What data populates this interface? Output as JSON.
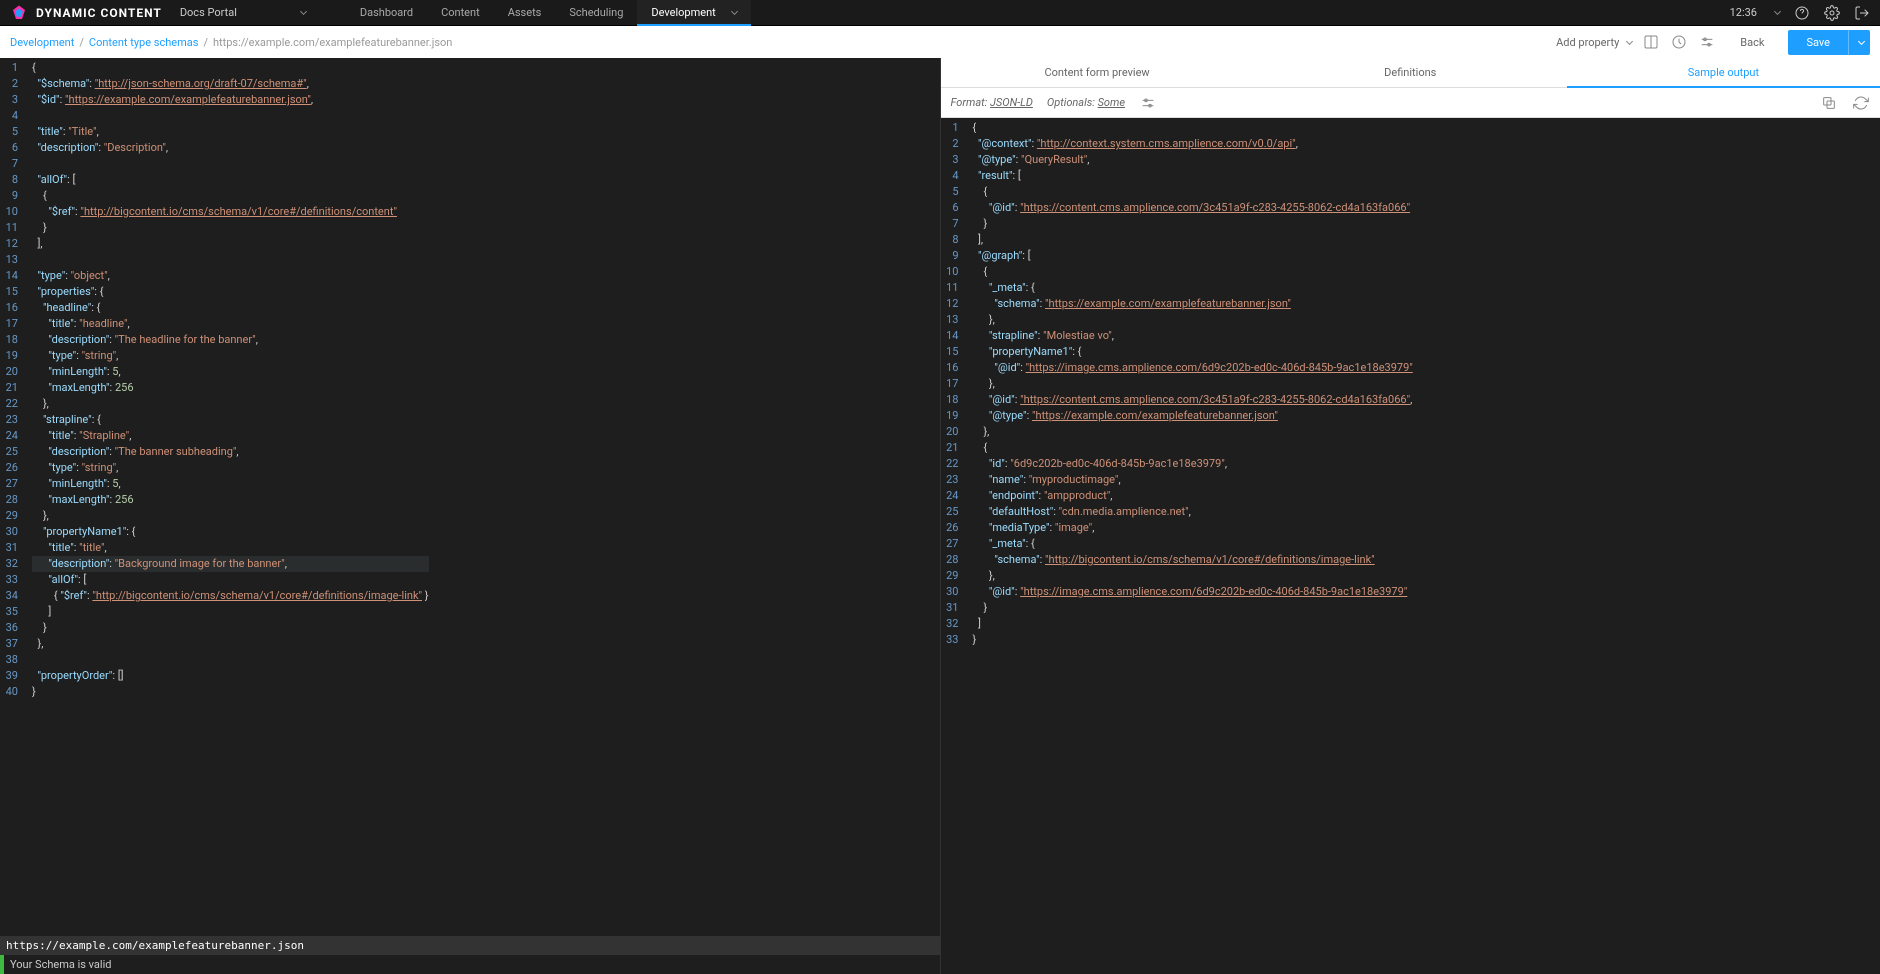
{
  "topbar": {
    "brand": "DYNAMIC CONTENT",
    "docs_portal": "Docs Portal",
    "tabs": [
      "Dashboard",
      "Content",
      "Assets",
      "Scheduling",
      "Development"
    ],
    "active_tab": 4,
    "clock": "12:36"
  },
  "subbar": {
    "crumbs": [
      "Development",
      "Content type schemas"
    ],
    "url": "https://example.com/examplefeaturebanner.json",
    "add_property": "Add property",
    "back": "Back",
    "save": "Save"
  },
  "left_editor": {
    "highlight_line": 32,
    "lines": [
      "{",
      "  \"$schema\": \"http://json-schema.org/draft-07/schema#\",",
      "  \"$id\": \"https://example.com/examplefeaturebanner.json\",",
      "",
      "  \"title\": \"Title\",",
      "  \"description\": \"Description\",",
      "",
      "  \"allOf\": [",
      "    {",
      "      \"$ref\": \"http://bigcontent.io/cms/schema/v1/core#/definitions/content\"",
      "    }",
      "  ],",
      "",
      "  \"type\": \"object\",",
      "  \"properties\": {",
      "    \"headline\": {",
      "      \"title\": \"headline\",",
      "      \"description\": \"The headline for the banner\",",
      "      \"type\": \"string\",",
      "      \"minLength\": 5,",
      "      \"maxLength\": 256",
      "    },",
      "    \"strapline\": {",
      "      \"title\": \"Strapline\",",
      "      \"description\": \"The banner subheading\",",
      "      \"type\": \"string\",",
      "      \"minLength\": 5,",
      "      \"maxLength\": 256",
      "    },",
      "    \"propertyName1\": {",
      "      \"title\": \"title\",",
      "      \"description\": \"Background image for the banner\",",
      "      \"allOf\": [",
      "        { \"$ref\": \"http://bigcontent.io/cms/schema/v1/core#/definitions/image-link\" }",
      "      ]",
      "    }",
      "  },",
      "",
      "  \"propertyOrder\": []",
      "}"
    ]
  },
  "right_panel": {
    "tabs": [
      "Content form preview",
      "Definitions",
      "Sample output"
    ],
    "active_tab": 2,
    "toolbar": {
      "format_label": "Format:",
      "format_value": "JSON-LD",
      "optionals_label": "Optionals:",
      "optionals_value": "Some"
    },
    "lines": [
      "{",
      "  \"@context\": \"http://context.system.cms.amplience.com/v0.0/api\",",
      "  \"@type\": \"QueryResult\",",
      "  \"result\": [",
      "    {",
      "      \"@id\": \"https://content.cms.amplience.com/3c451a9f-c283-4255-8062-cd4a163fa066\"",
      "    }",
      "  ],",
      "  \"@graph\": [",
      "    {",
      "      \"_meta\": {",
      "        \"schema\": \"https://example.com/examplefeaturebanner.json\"",
      "      },",
      "      \"strapline\": \"Molestiae vo\",",
      "      \"propertyName1\": {",
      "        \"@id\": \"https://image.cms.amplience.com/6d9c202b-ed0c-406d-845b-9ac1e18e3979\"",
      "      },",
      "      \"@id\": \"https://content.cms.amplience.com/3c451a9f-c283-4255-8062-cd4a163fa066\",",
      "      \"@type\": \"https://example.com/examplefeaturebanner.json\"",
      "    },",
      "    {",
      "      \"id\": \"6d9c202b-ed0c-406d-845b-9ac1e18e3979\",",
      "      \"name\": \"myproductimage\",",
      "      \"endpoint\": \"ampproduct\",",
      "      \"defaultHost\": \"cdn.media.amplience.net\",",
      "      \"mediaType\": \"image\",",
      "      \"_meta\": {",
      "        \"schema\": \"http://bigcontent.io/cms/schema/v1/core#/definitions/image-link\"",
      "      },",
      "      \"@id\": \"https://image.cms.amplience.com/6d9c202b-ed0c-406d-845b-9ac1e18e3979\"",
      "    }",
      "  ]",
      "}"
    ]
  },
  "status": {
    "url": "https://example.com/examplefeaturebanner.json",
    "message": "Your Schema is valid"
  }
}
